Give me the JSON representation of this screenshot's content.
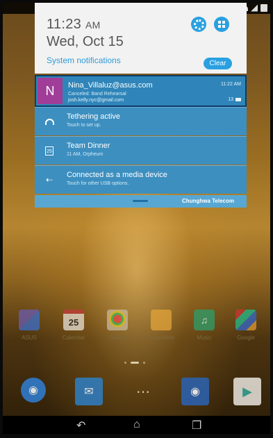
{
  "shade": {
    "time": "11:23",
    "ampm": "AM",
    "date": "Wed, Oct 15",
    "system_notifications_label": "System notifications",
    "clear_label": "Clear",
    "settings_icon": "gear-icon",
    "apps_icon": "grid-icon",
    "carrier": "Chunghwa Telecom"
  },
  "notifications": [
    {
      "avatar_letter": "N",
      "title": "Nina_Villaluz@asus.com",
      "subtitle": "Canceled: Band Rehearsal",
      "account": "josh.kelly.nyc@gmail.com",
      "time": "11:22 AM",
      "count": "13",
      "icon": "email-icon"
    },
    {
      "title": "Tethering active",
      "subtitle": "Touch to set up.",
      "icon": "wifi-hotspot-icon"
    },
    {
      "title": "Team Dinner",
      "subtitle": "11 AM, Orpheum",
      "icon": "calendar-icon",
      "icon_text": "25"
    },
    {
      "title": "Connected as a media device",
      "subtitle": "Touch for other USB options.",
      "icon": "usb-icon"
    }
  ],
  "apps": [
    {
      "label": "ASUS",
      "icon": "asus-folder-icon"
    },
    {
      "label": "Calendar",
      "icon": "calendar-icon",
      "icon_text": "25"
    },
    {
      "label": "Gallery",
      "icon": "gallery-icon"
    },
    {
      "label": "SuperNote",
      "icon": "supernote-icon"
    },
    {
      "label": "Music",
      "icon": "music-icon"
    },
    {
      "label": "Google",
      "icon": "google-folder-icon"
    }
  ],
  "dock": [
    {
      "icon": "browser-icon"
    },
    {
      "icon": "email-icon"
    },
    {
      "icon": "all-apps-icon"
    },
    {
      "icon": "camera-icon"
    },
    {
      "icon": "play-store-icon"
    }
  ],
  "navbar": {
    "back": "back-icon",
    "home": "home-icon",
    "recent": "recent-apps-icon"
  }
}
